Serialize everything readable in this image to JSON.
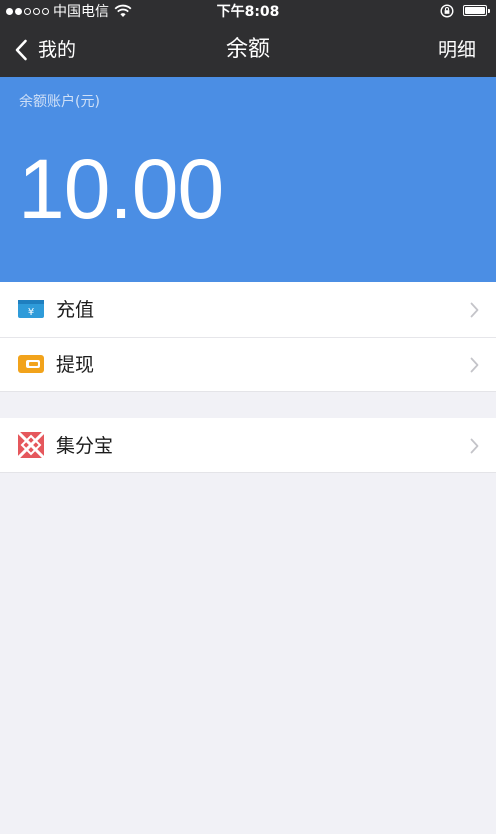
{
  "status_bar": {
    "carrier": "中国电信",
    "time": "下午8:08",
    "signal_icon": "signal-dots-icon",
    "wifi_icon": "wifi-icon",
    "lock_icon": "orientation-lock-icon",
    "battery_icon": "battery-icon"
  },
  "nav": {
    "back_label": "我的",
    "title": "余额",
    "right_label": "明细"
  },
  "balance": {
    "label": "余额账户(元)",
    "amount": "10.00"
  },
  "menu_group_1": [
    {
      "label": "充值",
      "icon": "recharge-card-icon"
    },
    {
      "label": "提现",
      "icon": "wallet-icon"
    }
  ],
  "menu_group_2": [
    {
      "label": "集分宝",
      "icon": "jifenbao-icon"
    }
  ],
  "colors": {
    "nav_bg": "#2f2f31",
    "balance_bg": "#4b8ee4",
    "page_bg": "#f1f1f6",
    "recharge_icon": "#2f9bd9",
    "wallet_icon": "#f2a31b",
    "jifenbao_icon": "#e5575c"
  }
}
